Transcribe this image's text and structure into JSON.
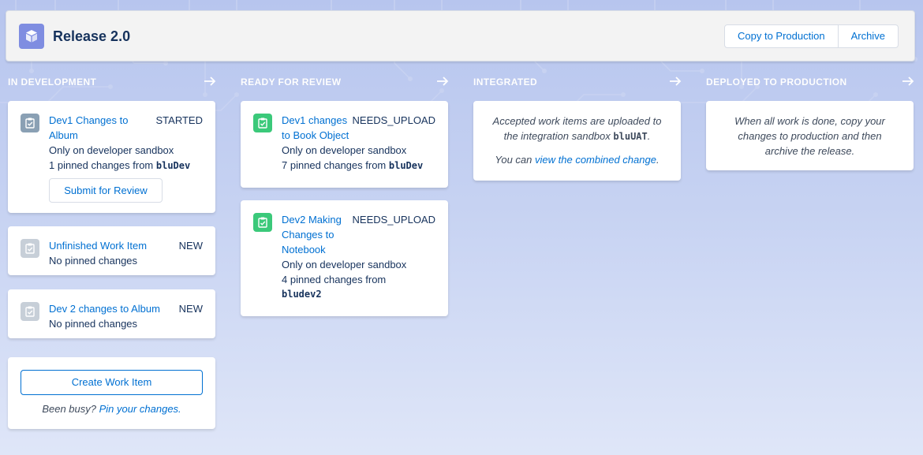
{
  "header": {
    "icon": "cube-icon",
    "title": "Release 2.0",
    "copy_button": "Copy to Production",
    "archive_button": "Archive"
  },
  "columns": [
    {
      "label": "IN DEVELOPMENT"
    },
    {
      "label": "READY FOR REVIEW"
    },
    {
      "label": "INTEGRATED"
    },
    {
      "label": "DEPLOYED TO PRODUCTION"
    }
  ],
  "development": {
    "items": [
      {
        "title": "Dev1 Changes to Album",
        "status": "STARTED",
        "line1": "Only on developer sandbox",
        "line2_pre": "1 pinned changes from ",
        "line2_sandbox": "bluDev",
        "action": "Submit for Review"
      },
      {
        "title": "Unfinished Work Item",
        "status": "NEW",
        "line1": "No pinned changes"
      },
      {
        "title": "Dev 2 changes to Album",
        "status": "NEW",
        "line1": "No pinned changes"
      }
    ],
    "create_button": "Create Work Item",
    "busy_text": "Been busy?",
    "pin_link": "Pin your changes."
  },
  "review": {
    "items": [
      {
        "title_l1": "Dev1 changes",
        "title_l2": "to Book Object",
        "status": "NEEDS_UPLOAD",
        "line1": "Only on developer sandbox",
        "line2_pre": "7 pinned changes from ",
        "line2_sandbox": "bluDev"
      },
      {
        "title_l1": "Dev2 Making",
        "title_l2": "Changes to",
        "title_l3": "Notebook",
        "status": "NEEDS_UPLOAD",
        "line1": "Only on developer sandbox",
        "line2_pre": "4 pinned changes from",
        "line2_sandbox": "bludev2"
      }
    ]
  },
  "integrated": {
    "text_l1": "Accepted work items are uploaded to",
    "text_l2_pre": "the integration sandbox ",
    "text_l2_sandbox": "bluUAT",
    "text_l2_post": ".",
    "cta_pre": "You can ",
    "cta_link": "view the combined change",
    "cta_post": "."
  },
  "deployed": {
    "text_l1": "When all work is done, copy your",
    "text_l2": "changes to production and then",
    "text_l3": "archive the release."
  },
  "colors": {
    "accent": "#0070d2",
    "app_icon": "#7f8de1",
    "ready_icon": "#3bc97a",
    "text": "#16325c"
  }
}
